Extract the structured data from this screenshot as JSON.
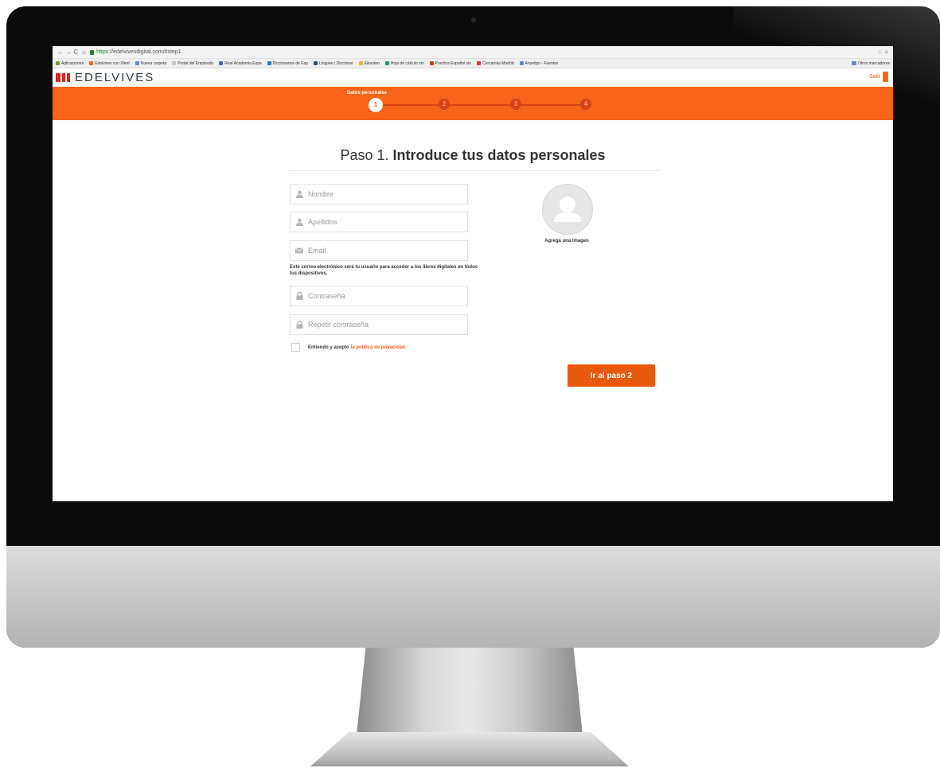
{
  "browser": {
    "nav_icons": "← → C",
    "home_icon": "⌂",
    "url_scheme": "https",
    "url_rest": "://edelvivesdigital.com/#step1",
    "bookmarks": [
      {
        "label": "Aplicaciones",
        "color": "#7a9a3a"
      },
      {
        "label": "Edelvives con Xlent",
        "color": "#f06a1e"
      },
      {
        "label": "Nueva carpeta",
        "color": "#5b8fd6"
      },
      {
        "label": "Portal del Empleado",
        "color": "#c8c8c8"
      },
      {
        "label": "Real Academia Espa",
        "color": "#3b6bb0"
      },
      {
        "label": "Diccionarios de Esp",
        "color": "#2a79c7"
      },
      {
        "label": "Linguee | Diccionar",
        "color": "#1f4f8a"
      },
      {
        "label": "Eikasten",
        "color": "#f0b030"
      },
      {
        "label": "Hoja de cálculo sin",
        "color": "#21a366"
      },
      {
        "label": "Practica Español sin",
        "color": "#d83a2a"
      },
      {
        "label": "Cercanías Madrid",
        "color": "#e03a3a"
      },
      {
        "label": "Anyetipo - Fuentes",
        "color": "#5b8fd6"
      }
    ],
    "other_bookmarks": "Otros marcadores"
  },
  "header": {
    "logo_text": "EDELVIVES",
    "logo_color": "#d7261e",
    "exit_label": "Salir"
  },
  "progress": {
    "current_label": "Datos personales",
    "steps": [
      "1",
      "2",
      "3",
      "4"
    ],
    "current_step": 1,
    "accent": "#f6631b"
  },
  "page": {
    "title_prefix": "Paso 1.",
    "title_main": "Introduce tus datos personales"
  },
  "form": {
    "nombre_placeholder": "Nombre",
    "apellidos_placeholder": "Apellidos",
    "email_placeholder": "Email",
    "email_help": "Este correo electrónico será tu usuario para acceder a los libros digitales en todos tus dispositivos.",
    "password_placeholder": "Contraseña",
    "repeat_password_placeholder": "Repetir contraseña",
    "accept_text": "Entiendo y acepto",
    "privacy_link": "la política de privacidad."
  },
  "avatar": {
    "label": "Agrega una imagen"
  },
  "actions": {
    "next_label": "Ir al paso 2"
  }
}
